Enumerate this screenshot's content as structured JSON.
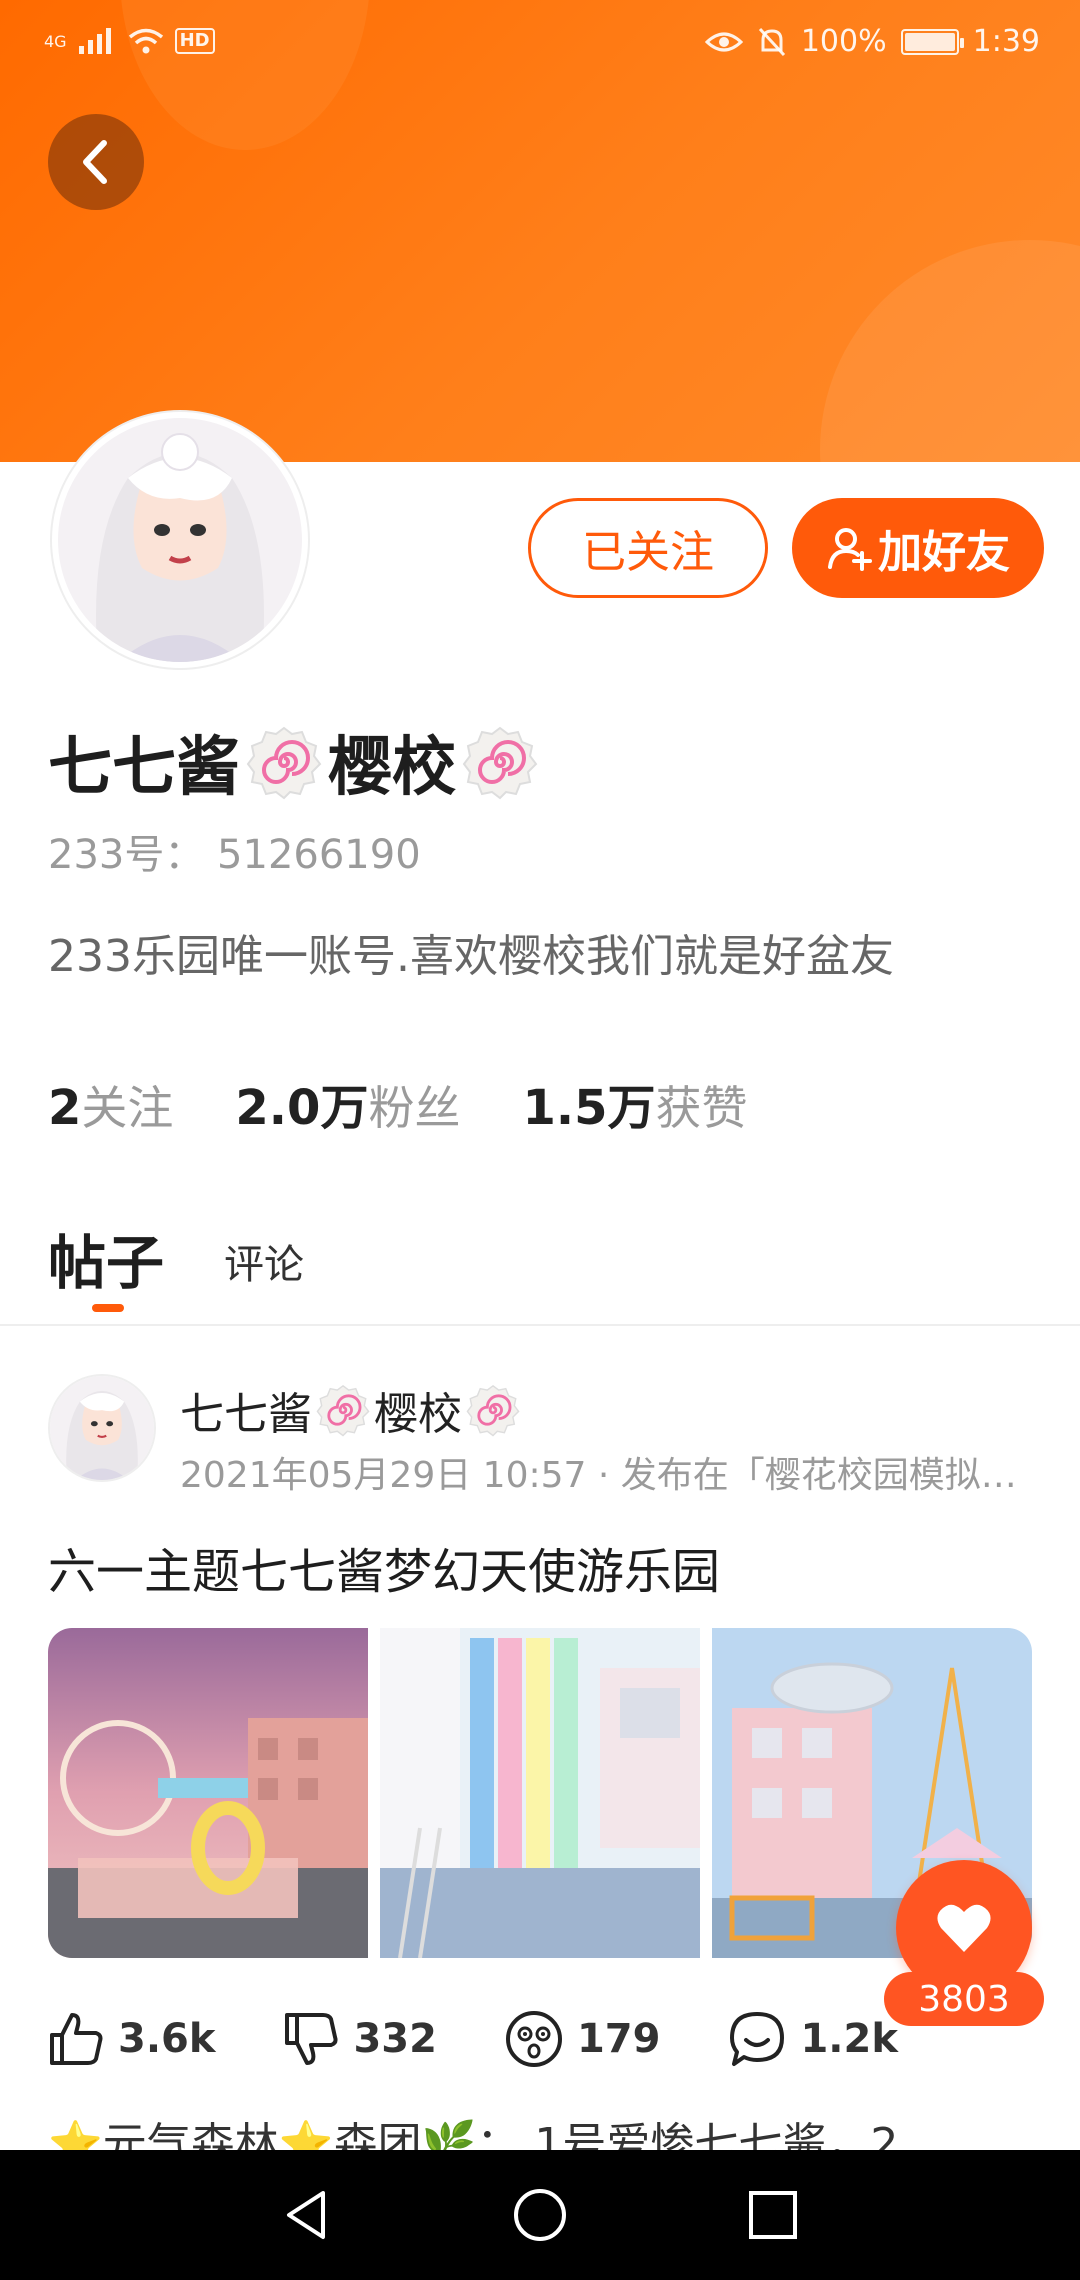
{
  "status_bar": {
    "network": "4G",
    "hd": "HD",
    "battery": "100%",
    "time": "1:39"
  },
  "profile": {
    "follow_button": "已关注",
    "add_friend_button": "加好友",
    "name_part1": "七七酱",
    "name_part2": "樱校",
    "account_id": "233号： 51266190",
    "bio": "233乐园唯一账号.喜欢樱校我们就是好盆友",
    "stats": [
      {
        "value": "2",
        "label": "关注"
      },
      {
        "value": "2.0万",
        "label": "粉丝"
      },
      {
        "value": "1.5万",
        "label": "获赞"
      }
    ]
  },
  "tabs": {
    "active": "帖子",
    "other": "评论"
  },
  "post": {
    "author_part1": "七七酱",
    "author_part2": "樱校",
    "meta": "2021年05月29日 10:57 · 发布在「樱花校园模拟…",
    "title": "六一主题七七酱梦幻天使游乐园",
    "like_count": "3803",
    "actions": {
      "thumbs_up": "3.6k",
      "thumbs_down": "332",
      "wow": "179",
      "comments": "1.2k"
    }
  },
  "next_preview": "⭐元气森林⭐森团🌿： 1号爱惨七七酱，2",
  "colors": {
    "accent": "#ff5a0a",
    "header": "#ff6a00",
    "like": "#ff5522"
  }
}
